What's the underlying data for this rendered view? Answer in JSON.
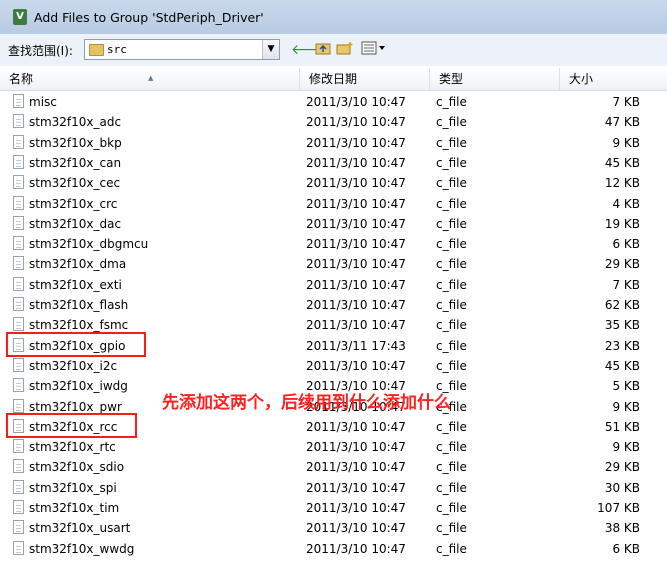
{
  "window": {
    "title": "Add Files to Group 'StdPeriph_Driver'",
    "icon_label": "V"
  },
  "lookin": {
    "label": "查找范围(I):",
    "value": "src"
  },
  "toolbar": {
    "back_icon": "arrow-left",
    "up_icon": "folder-up",
    "new_folder_icon": "new-folder",
    "view_icon": "view-menu"
  },
  "columns": {
    "name": "名称",
    "date": "修改日期",
    "type": "类型",
    "size": "大小"
  },
  "files": [
    {
      "name": "misc",
      "date": "2011/3/10 10:47",
      "type": "c_file",
      "size": "7 KB"
    },
    {
      "name": "stm32f10x_adc",
      "date": "2011/3/10 10:47",
      "type": "c_file",
      "size": "47 KB"
    },
    {
      "name": "stm32f10x_bkp",
      "date": "2011/3/10 10:47",
      "type": "c_file",
      "size": "9 KB"
    },
    {
      "name": "stm32f10x_can",
      "date": "2011/3/10 10:47",
      "type": "c_file",
      "size": "45 KB"
    },
    {
      "name": "stm32f10x_cec",
      "date": "2011/3/10 10:47",
      "type": "c_file",
      "size": "12 KB"
    },
    {
      "name": "stm32f10x_crc",
      "date": "2011/3/10 10:47",
      "type": "c_file",
      "size": "4 KB"
    },
    {
      "name": "stm32f10x_dac",
      "date": "2011/3/10 10:47",
      "type": "c_file",
      "size": "19 KB"
    },
    {
      "name": "stm32f10x_dbgmcu",
      "date": "2011/3/10 10:47",
      "type": "c_file",
      "size": "6 KB"
    },
    {
      "name": "stm32f10x_dma",
      "date": "2011/3/10 10:47",
      "type": "c_file",
      "size": "29 KB"
    },
    {
      "name": "stm32f10x_exti",
      "date": "2011/3/10 10:47",
      "type": "c_file",
      "size": "7 KB"
    },
    {
      "name": "stm32f10x_flash",
      "date": "2011/3/10 10:47",
      "type": "c_file",
      "size": "62 KB"
    },
    {
      "name": "stm32f10x_fsmc",
      "date": "2011/3/10 10:47",
      "type": "c_file",
      "size": "35 KB"
    },
    {
      "name": "stm32f10x_gpio",
      "date": "2011/3/11 17:43",
      "type": "c_file",
      "size": "23 KB",
      "highlight": true
    },
    {
      "name": "stm32f10x_i2c",
      "date": "2011/3/10 10:47",
      "type": "c_file",
      "size": "45 KB"
    },
    {
      "name": "stm32f10x_iwdg",
      "date": "2011/3/10 10:47",
      "type": "c_file",
      "size": "5 KB"
    },
    {
      "name": "stm32f10x_pwr",
      "date": "2011/3/10 10:47",
      "type": "c_file",
      "size": "9 KB"
    },
    {
      "name": "stm32f10x_rcc",
      "date": "2011/3/10 10:47",
      "type": "c_file",
      "size": "51 KB",
      "highlight": true
    },
    {
      "name": "stm32f10x_rtc",
      "date": "2011/3/10 10:47",
      "type": "c_file",
      "size": "9 KB"
    },
    {
      "name": "stm32f10x_sdio",
      "date": "2011/3/10 10:47",
      "type": "c_file",
      "size": "29 KB"
    },
    {
      "name": "stm32f10x_spi",
      "date": "2011/3/10 10:47",
      "type": "c_file",
      "size": "30 KB"
    },
    {
      "name": "stm32f10x_tim",
      "date": "2011/3/10 10:47",
      "type": "c_file",
      "size": "107 KB"
    },
    {
      "name": "stm32f10x_usart",
      "date": "2011/3/10 10:47",
      "type": "c_file",
      "size": "38 KB"
    },
    {
      "name": "stm32f10x_wwdg",
      "date": "2011/3/10 10:47",
      "type": "c_file",
      "size": "6 KB"
    }
  ],
  "annotation": {
    "text": "先添加这两个，后续用到什么添加什么",
    "color": "#ff2020"
  }
}
